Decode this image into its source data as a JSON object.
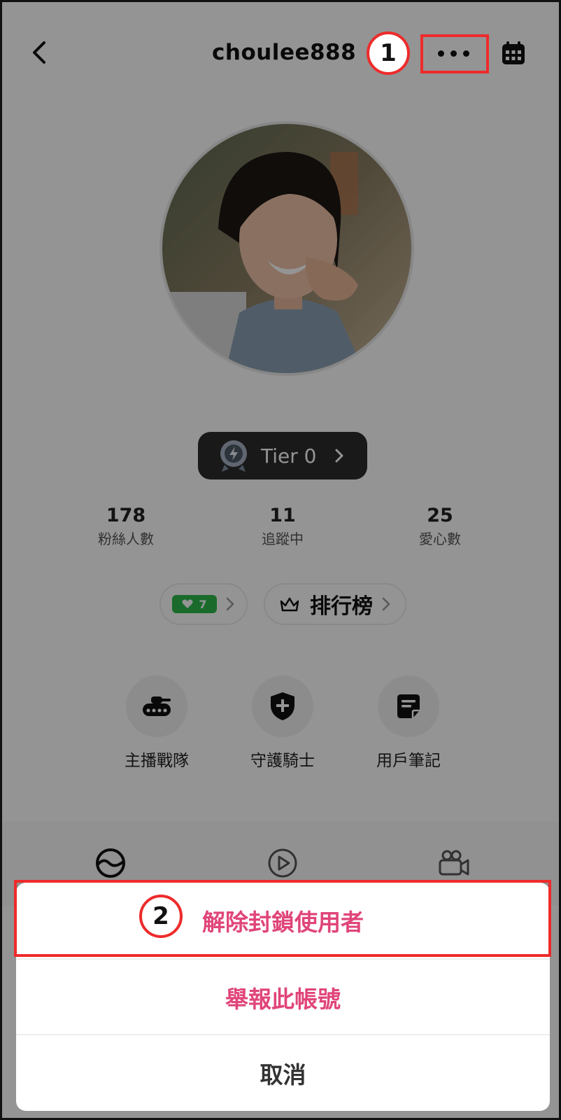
{
  "header": {
    "username": "choulee888"
  },
  "tier": {
    "label": "Tier 0"
  },
  "stats": [
    {
      "value": "178",
      "label": "粉絲人數"
    },
    {
      "value": "11",
      "label": "追蹤中"
    },
    {
      "value": "25",
      "label": "愛心數"
    }
  ],
  "heart_badge": {
    "count": "7"
  },
  "ranking": {
    "label": "排行榜"
  },
  "features": [
    {
      "label": "主播戰隊",
      "icon": "tank-icon"
    },
    {
      "label": "守護騎士",
      "icon": "shield-plus-icon"
    },
    {
      "label": "用戶筆記",
      "icon": "note-icon"
    }
  ],
  "tabs": [
    {
      "icon": "moments-icon"
    },
    {
      "icon": "play-icon"
    },
    {
      "icon": "video-camera-icon"
    }
  ],
  "sheet": {
    "unblock": "解除封鎖使用者",
    "report": "舉報此帳號",
    "cancel": "取消"
  },
  "annotations": {
    "step1": "1",
    "step2": "2"
  },
  "colors": {
    "accent_pink": "#e0457a",
    "highlight_red": "#ee2b2b",
    "green_badge": "#2db84b",
    "tier_bg": "#2b2b2b"
  }
}
